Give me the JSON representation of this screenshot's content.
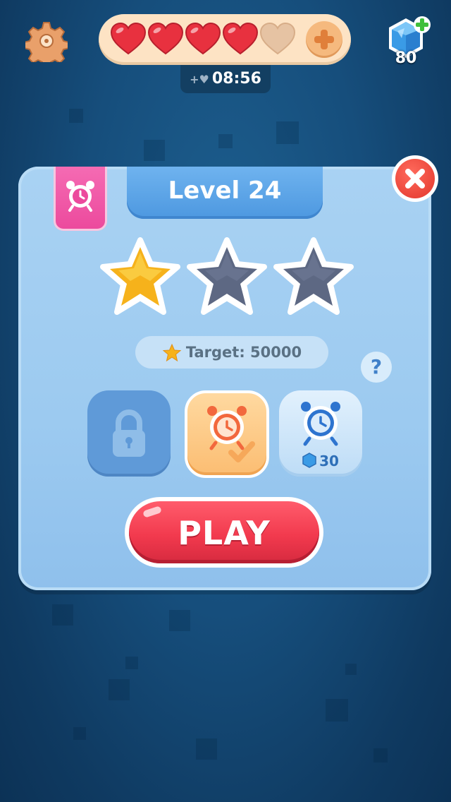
{
  "header": {
    "lives_full": 4,
    "lives_total": 5,
    "timer": "08:56",
    "gems": "80"
  },
  "level": {
    "title": "Level 24",
    "stars_earned": 1,
    "stars_total": 3,
    "target_label": "Target: 50000"
  },
  "boosters": [
    {
      "name": "locked",
      "state": "locked"
    },
    {
      "name": "alarm-clock",
      "state": "selected"
    },
    {
      "name": "alarm-clock-blue",
      "price": "30"
    }
  ],
  "help_label": "?",
  "play_label": "PLAY",
  "colors": {
    "heart": "#e8313f",
    "accent_red": "#f23a4e",
    "panel_blue": "#9ccaf0",
    "gold_star": "#f6b21b",
    "pink_ribbon": "#ec4a9d"
  }
}
